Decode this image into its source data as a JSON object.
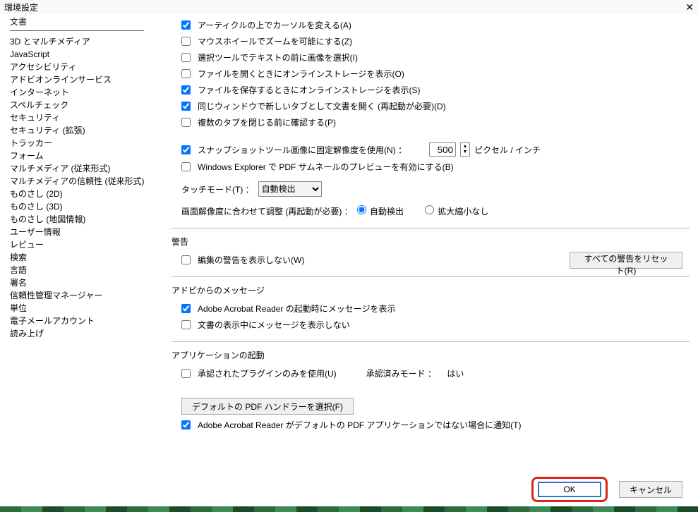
{
  "title": "環境設定",
  "sidebar": {
    "items": [
      "文書",
      "3D とマルチメディア",
      "JavaScript",
      "アクセシビリティ",
      "アドビオンラインサービス",
      "インターネット",
      "スペルチェック",
      "セキュリティ",
      "セキュリティ (拡張)",
      "トラッカー",
      "フォーム",
      "マルチメディア (従来形式)",
      "マルチメディアの信頼性 (従来形式)",
      "ものさし (2D)",
      "ものさし (3D)",
      "ものさし (地図情報)",
      "ユーザー情報",
      "レビュー",
      "検索",
      "言語",
      "署名",
      "信頼性管理マネージャー",
      "単位",
      "電子メールアカウント",
      "読み上げ"
    ],
    "selected": "文書"
  },
  "options": {
    "change_cursor_over_article": "アーティクルの上でカーソルを変える(A)",
    "mouse_wheel_zoom": "マウスホイールでズームを可能にする(Z)",
    "select_image_before_text": "選択ツールでテキストの前に画像を選択(I)",
    "show_online_on_open": "ファイルを開くときにオンラインストレージを表示(O)",
    "show_online_on_save": "ファイルを保存するときにオンラインストレージを表示(S)",
    "open_in_same_window": "同じウィンドウで新しいタブとして文書を開く (再起動が必要)(D)",
    "confirm_close_tabs": "複数のタブを閉じる前に確認する(P)",
    "snapshot_fixed_res": "スナップショットツール画像に固定解像度を使用(N) ：",
    "snapshot_value": "500",
    "snapshot_unit": "ピクセル / インチ",
    "explorer_thumbnail": "Windows Explorer で PDF サムネールのプレビューを有効にする(B)",
    "touch_mode_label": "タッチモード(T) ：",
    "touch_mode_value": "自動検出",
    "resolution_label": "画面解像度に合わせて調整 (再起動が必要) ：",
    "resolution_auto": "自動検出",
    "resolution_none": "拡大縮小なし"
  },
  "warnings": {
    "heading": "警告",
    "dont_show_edit_warning": "編集の警告を表示しない(W)",
    "reset_button": "すべての警告をリセット(R)"
  },
  "adobe_messages": {
    "heading": "アドビからのメッセージ",
    "show_on_launch": "Adobe Acrobat Reader の起動時にメッセージを表示",
    "dont_show_during_view": "文書の表示中にメッセージを表示しない"
  },
  "app_launch": {
    "heading": "アプリケーションの起動",
    "use_approved_plugins": "承認されたプラグインのみを使用(U)",
    "approved_mode_label": "承認済みモード ：",
    "approved_mode_value": "はい",
    "default_handler_btn": "デフォルトの PDF ハンドラーを選択(F)",
    "notify_not_default": "Adobe Acrobat Reader がデフォルトの PDF アプリケーションではない場合に通知(T)"
  },
  "footer": {
    "ok": "OK",
    "cancel": "キャンセル"
  }
}
